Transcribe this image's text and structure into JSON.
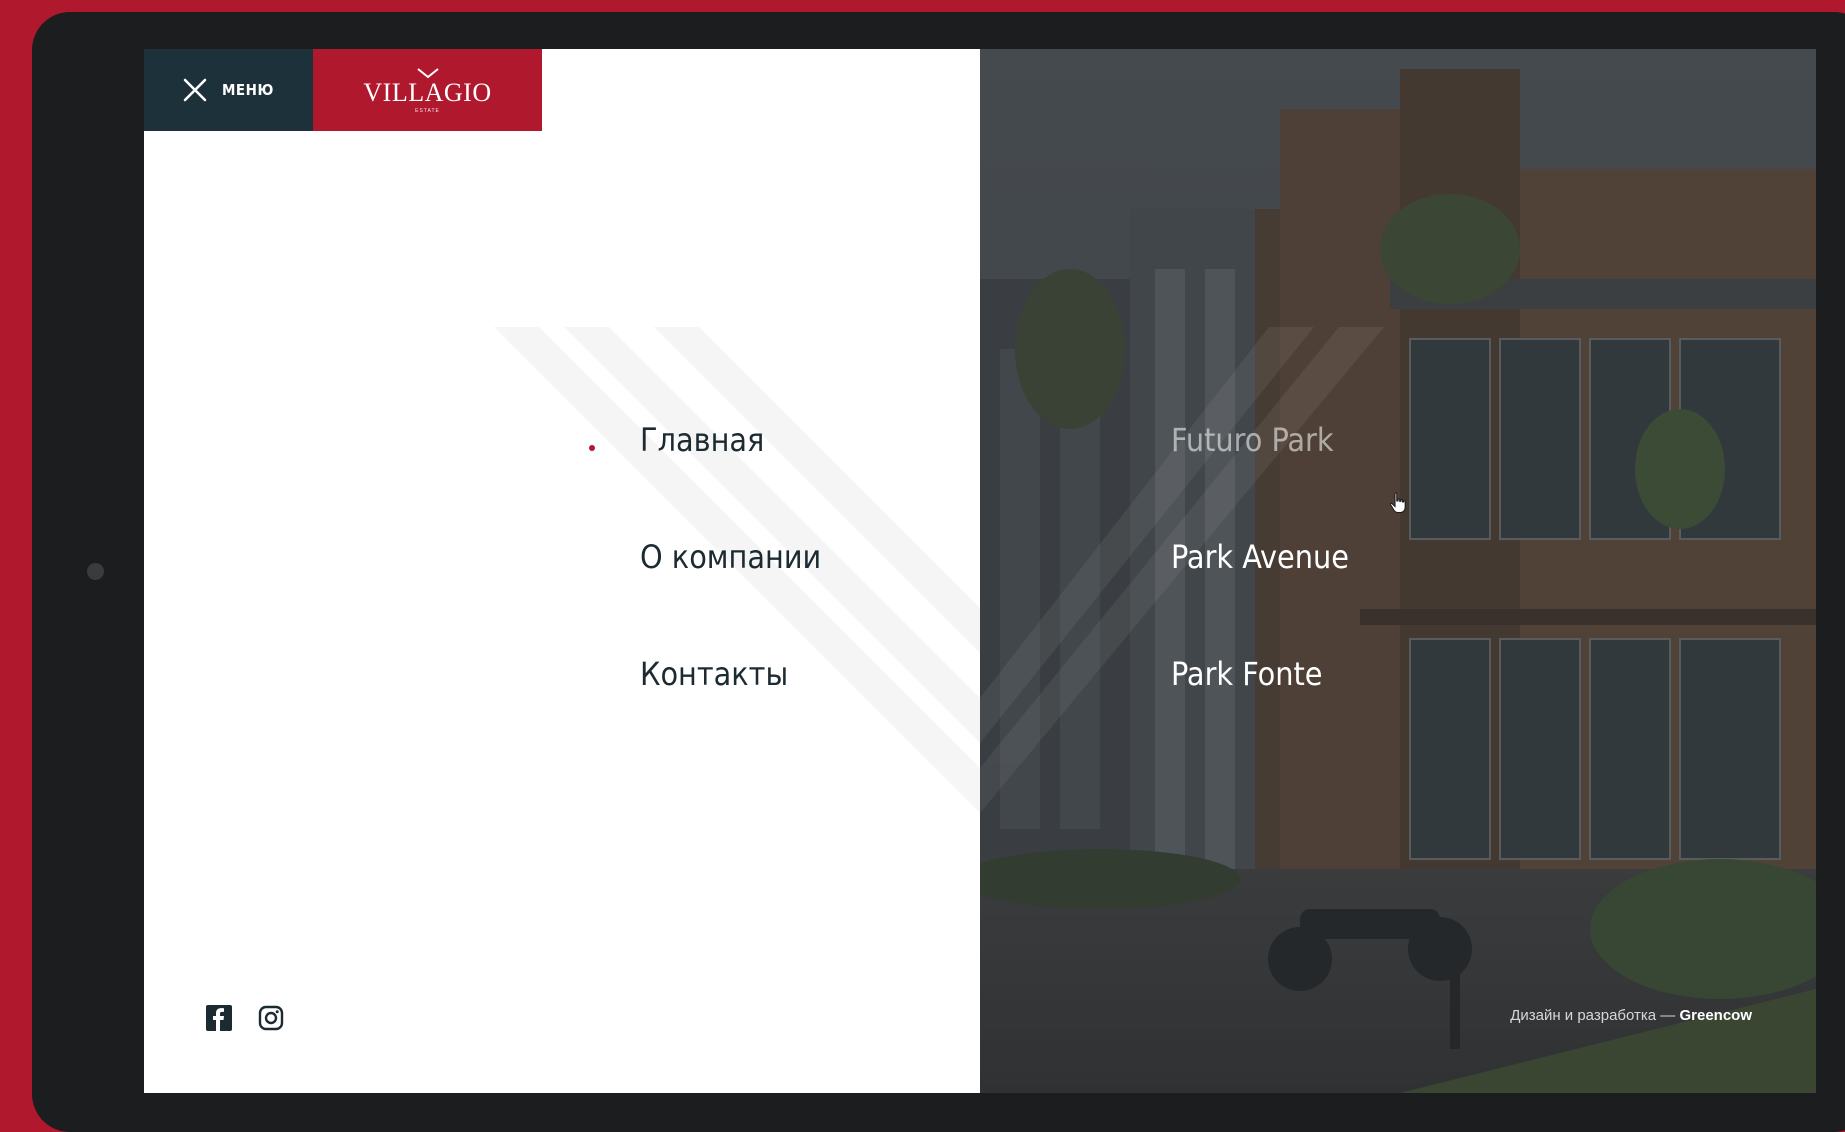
{
  "header": {
    "menu_label": "МЕНЮ",
    "close_icon": "close-icon",
    "logo_name": "VILLAGIO",
    "logo_sub": "ESTATE"
  },
  "nav": {
    "items": [
      {
        "label": "Главная",
        "active": true
      },
      {
        "label": "О компании",
        "active": false
      },
      {
        "label": "Контакты",
        "active": false
      }
    ]
  },
  "projects": {
    "items": [
      {
        "label": "Futuro Park",
        "hovered": true
      },
      {
        "label": "Park Avenue",
        "hovered": false
      },
      {
        "label": "Park Fonte",
        "hovered": false
      }
    ]
  },
  "social": {
    "facebook_icon": "facebook-icon",
    "instagram_icon": "instagram-icon"
  },
  "footer": {
    "credits_prefix": "Дизайн и разработка — ",
    "credits_studio": "Greencow"
  },
  "colors": {
    "accent": "#b0182e",
    "dark_teal": "#1c3139",
    "bezel": "#1c1d1f"
  }
}
